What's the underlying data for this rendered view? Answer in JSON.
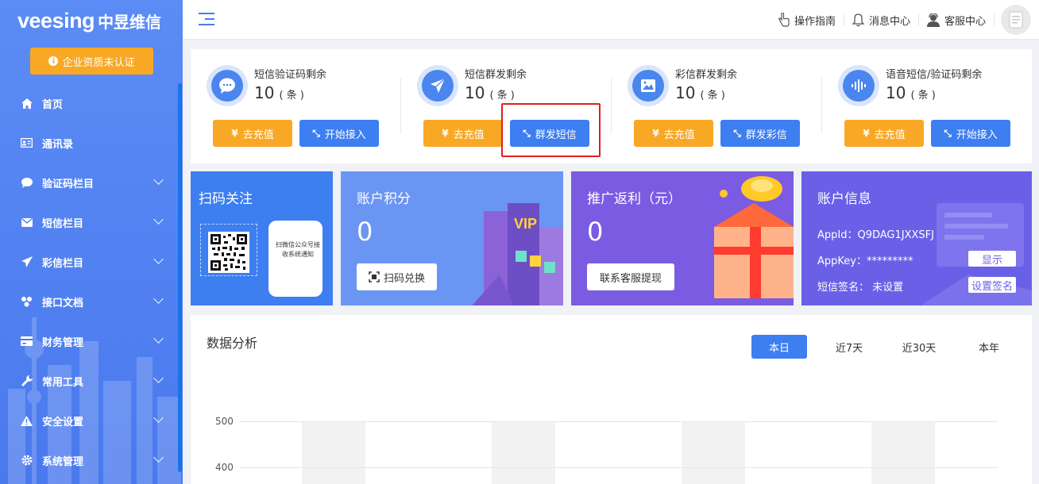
{
  "app": {
    "brand": "veesing",
    "brand_cn": "中昱维信",
    "cert_button": "企业资质未认证"
  },
  "sidebar": {
    "items": [
      {
        "label": "首页",
        "icon": "home-icon",
        "expandable": false
      },
      {
        "label": "通讯录",
        "icon": "contacts-icon",
        "expandable": false
      },
      {
        "label": "验证码栏目",
        "icon": "chat-icon",
        "expandable": true
      },
      {
        "label": "短信栏目",
        "icon": "mail-icon",
        "expandable": true
      },
      {
        "label": "彩信栏目",
        "icon": "send-icon",
        "expandable": true
      },
      {
        "label": "接口文档",
        "icon": "api-icon",
        "expandable": true
      },
      {
        "label": "财务管理",
        "icon": "finance-icon",
        "expandable": true
      },
      {
        "label": "常用工具",
        "icon": "wrench-icon",
        "expandable": true
      },
      {
        "label": "安全设置",
        "icon": "warning-icon",
        "expandable": true
      },
      {
        "label": "系统管理",
        "icon": "gear-icon",
        "expandable": true
      }
    ]
  },
  "header": {
    "guide": "操作指南",
    "messages": "消息中心",
    "service": "客服中心"
  },
  "balances": [
    {
      "title": "短信验证码剩余",
      "value": "10",
      "unit": "( 条 )",
      "recharge": "去充值",
      "action": "开始接入",
      "icon": "chat-bubble-icon"
    },
    {
      "title": "短信群发剩余",
      "value": "10",
      "unit": "( 条 )",
      "recharge": "去充值",
      "action": "群发短信",
      "icon": "paper-plane-icon"
    },
    {
      "title": "彩信群发剩余",
      "value": "10",
      "unit": "( 条 )",
      "recharge": "去充值",
      "action": "群发彩信",
      "icon": "image-icon"
    },
    {
      "title": "语音短信/验证码剩余",
      "value": "10",
      "unit": "( 条 )",
      "recharge": "去充值",
      "action": "开始接入",
      "icon": "voice-wave-icon"
    }
  ],
  "currency_symbol": "¥",
  "cards": {
    "scan": {
      "title": "扫码关注",
      "phone_text": "扫微信公众号接收系统通知"
    },
    "points": {
      "title": "账户积分",
      "value": "0",
      "button": "扫码兑换"
    },
    "rebate": {
      "title": "推广返利（元）",
      "value": "0",
      "button": "联系客服提现"
    },
    "account": {
      "title": "账户信息",
      "appid_label": "AppId：",
      "appid": "Q9DAG1JXXSFJ",
      "appkey_label": "AppKey：",
      "appkey": "*********",
      "show_button": "显示",
      "sign_label": "短信签名：",
      "sign_value": "未设置",
      "sign_button": "设置签名"
    }
  },
  "analysis": {
    "title": "数据分析",
    "tabs": [
      "本日",
      "近7天",
      "近30天",
      "本年"
    ],
    "active_tab": 0
  },
  "chart_data": {
    "type": "bar",
    "yticks": [
      500,
      400
    ],
    "categories": [],
    "values": []
  },
  "colors": {
    "primary": "#3d7ef0",
    "orange": "#f9a825",
    "highlight": "#e02020"
  }
}
